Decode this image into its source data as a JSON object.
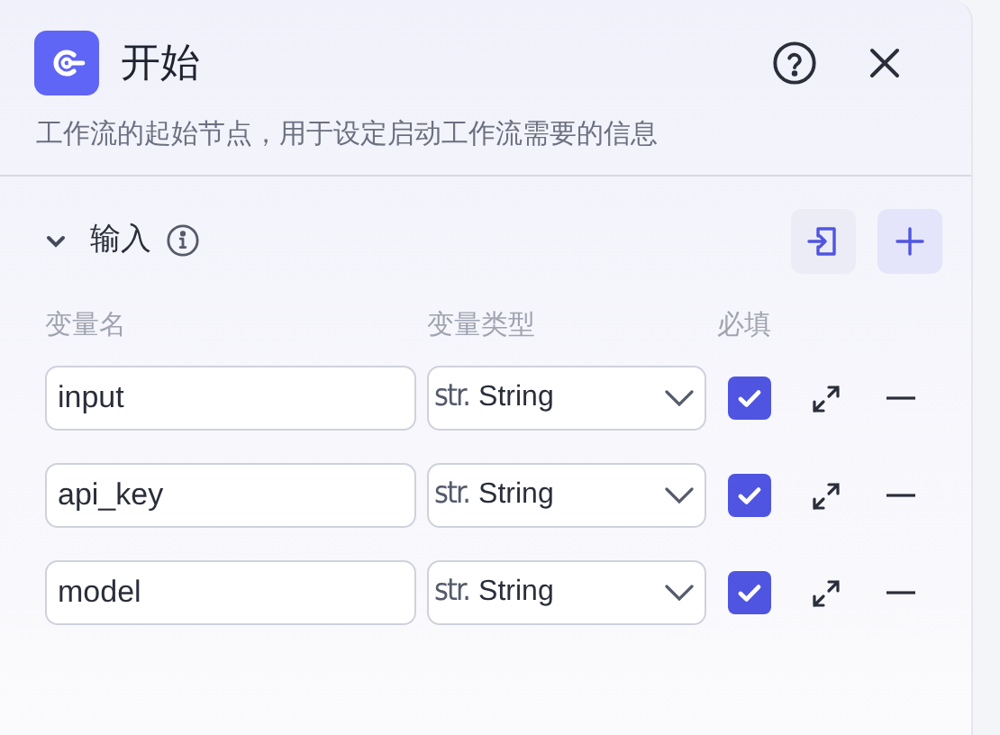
{
  "header": {
    "title": "开始",
    "description": "工作流的起始节点，用于设定启动工作流需要的信息"
  },
  "section": {
    "title": "输入",
    "expanded": true
  },
  "columns": [
    "变量名",
    "变量类型",
    "必填"
  ],
  "variables": [
    {
      "name": "input",
      "type_prefix": "str.",
      "type": "String",
      "required": true
    },
    {
      "name": "api_key",
      "type_prefix": "str.",
      "type": "String",
      "required": true
    },
    {
      "name": "model",
      "type_prefix": "str.",
      "type": "String",
      "required": true
    }
  ]
}
